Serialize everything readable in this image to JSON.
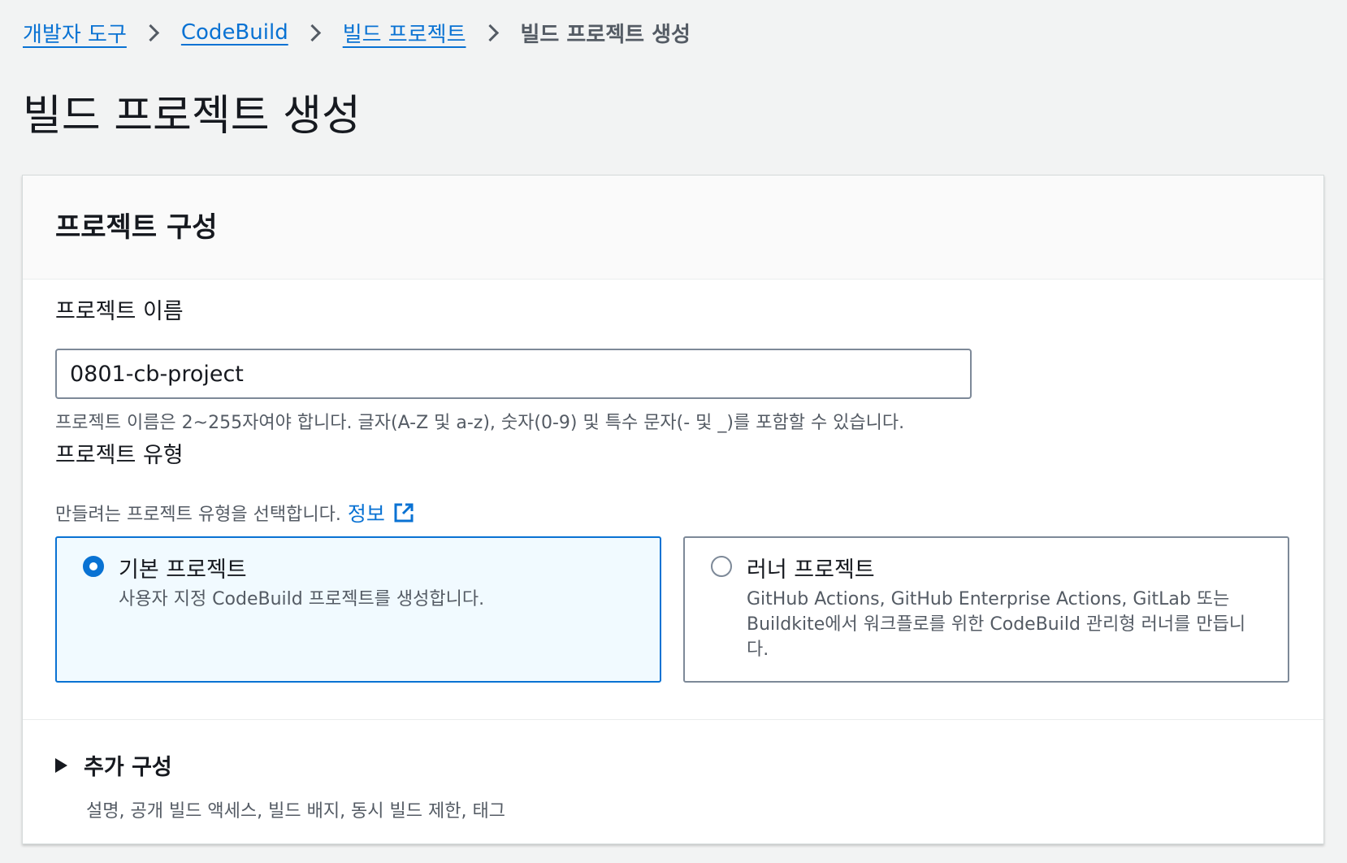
{
  "breadcrumb": {
    "items": [
      {
        "label": "개발자 도구"
      },
      {
        "label": "CodeBuild"
      },
      {
        "label": "빌드 프로젝트"
      }
    ],
    "current": "빌드 프로젝트 생성"
  },
  "page": {
    "title": "빌드 프로젝트 생성"
  },
  "panel": {
    "title": "프로젝트 구성",
    "project_name": {
      "label": "프로젝트 이름",
      "value": "0801-cb-project",
      "constraint": "프로젝트 이름은 2~255자여야 합니다. 글자(A-Z 및 a-z), 숫자(0-9) 및 특수 문자(- 및 _)를 포함할 수 있습니다."
    },
    "project_type": {
      "label": "프로젝트 유형",
      "description": "만들려는 프로젝트 유형을 선택합니다.",
      "info_link": "정보",
      "info_icon": "external-link-icon",
      "options": [
        {
          "title": "기본 프로젝트",
          "description": "사용자 지정 CodeBuild 프로젝트를 생성합니다.",
          "selected": true
        },
        {
          "title": "러너 프로젝트",
          "description": "GitHub Actions, GitHub Enterprise Actions, GitLab 또는 Buildkite에서 워크플로를 위한 CodeBuild 관리형 러너를 만듭니다.",
          "selected": false
        }
      ]
    },
    "additional": {
      "title": "추가 구성",
      "description": "설명, 공개 빌드 액세스, 빌드 배지, 동시 빌드 제한, 태그",
      "icon": "caret-right-icon"
    }
  },
  "colors": {
    "accent": "#0972d3",
    "background": "#f2f3f3",
    "selected_tile_bg": "#f1faff",
    "secondary_text": "#545b64"
  }
}
